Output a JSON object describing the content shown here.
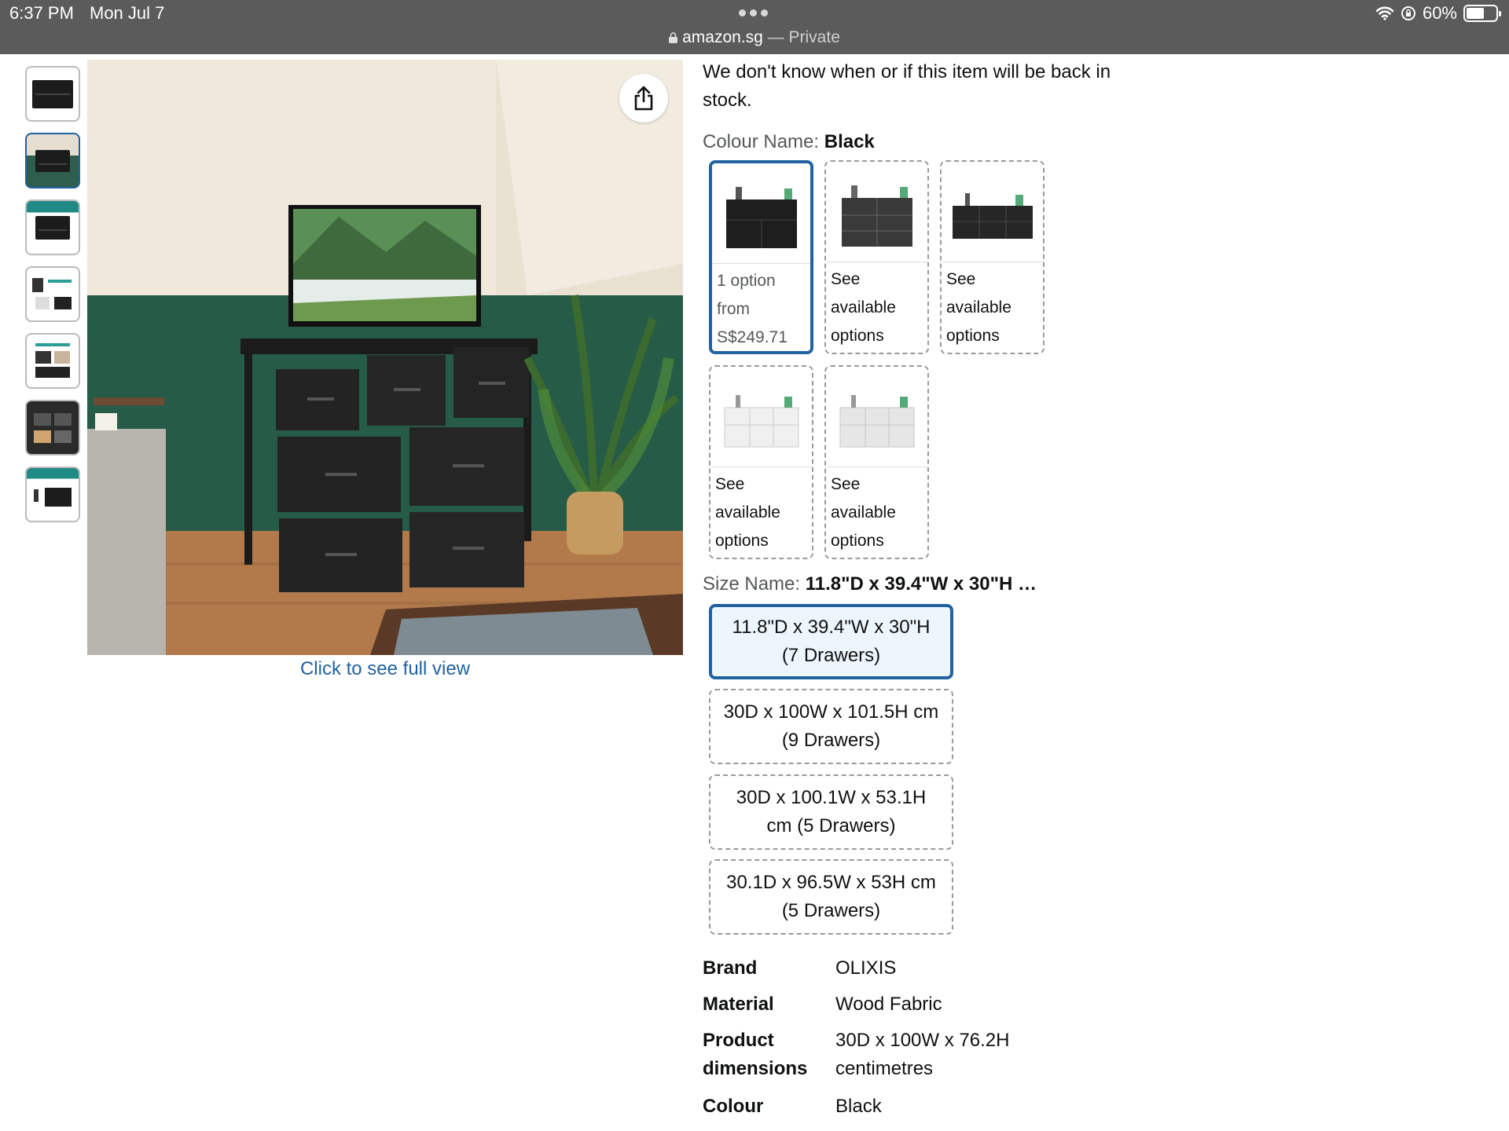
{
  "status_bar": {
    "time": "6:37 PM",
    "date": "Mon Jul 7",
    "battery": "60%",
    "battery_level": 0.6
  },
  "url_bar": {
    "domain": "amazon.sg",
    "separator": " — ",
    "mode": "Private"
  },
  "gallery": {
    "thumbnail_count": 7,
    "selected_index": 1,
    "full_view_link": "Click to see full view"
  },
  "availability": {
    "message": "We don't know when or if this item will be back in stock."
  },
  "colour": {
    "label": "Colour Name: ",
    "selected": "Black",
    "options": [
      {
        "line1": "1 option",
        "line2": "from",
        "line3": "S$249.71",
        "shade": "#1e1e1e",
        "selected": true
      },
      {
        "line1": "See",
        "line2": "available",
        "line3": "options",
        "shade": "#3a3a3a",
        "selected": false
      },
      {
        "line1": "See",
        "line2": "available",
        "line3": "options",
        "shade": "#262626",
        "selected": false
      },
      {
        "line1": "See",
        "line2": "available",
        "line3": "options",
        "shade": "#eeeeee",
        "selected": false
      },
      {
        "line1": "See",
        "line2": "available",
        "line3": "options",
        "shade": "#e6e6e6",
        "selected": false
      }
    ]
  },
  "size": {
    "label": "Size Name: ",
    "selected": "11.8\"D x 39.4\"W x 30\"H …",
    "options": [
      {
        "line1": "11.8\"D x 39.4\"W x 30\"H",
        "line2": "(7 Drawers)",
        "selected": true
      },
      {
        "line1": "30D x 100W x 101.5H cm",
        "line2": "(9 Drawers)",
        "selected": false
      },
      {
        "line1": "30D x 100.1W x 53.1H",
        "line2": "cm (5 Drawers)",
        "selected": false
      },
      {
        "line1": "30.1D x 96.5W x 53H cm",
        "line2": "(5 Drawers)",
        "selected": false
      }
    ]
  },
  "specs": [
    {
      "key": "Brand",
      "value": "OLIXIS"
    },
    {
      "key": "Material",
      "value": "Wood Fabric"
    },
    {
      "key_line1": "Product",
      "key_line2": "dimensions",
      "value_line1": "30D x 100W x 76.2H",
      "value_line2": "centimetres"
    },
    {
      "key": "Colour",
      "value": "Black"
    }
  ],
  "icons": {
    "share": "share-icon",
    "wifi": "wifi-icon",
    "lock": "lock-icon",
    "rotation_lock": "rotation-lock-icon"
  }
}
